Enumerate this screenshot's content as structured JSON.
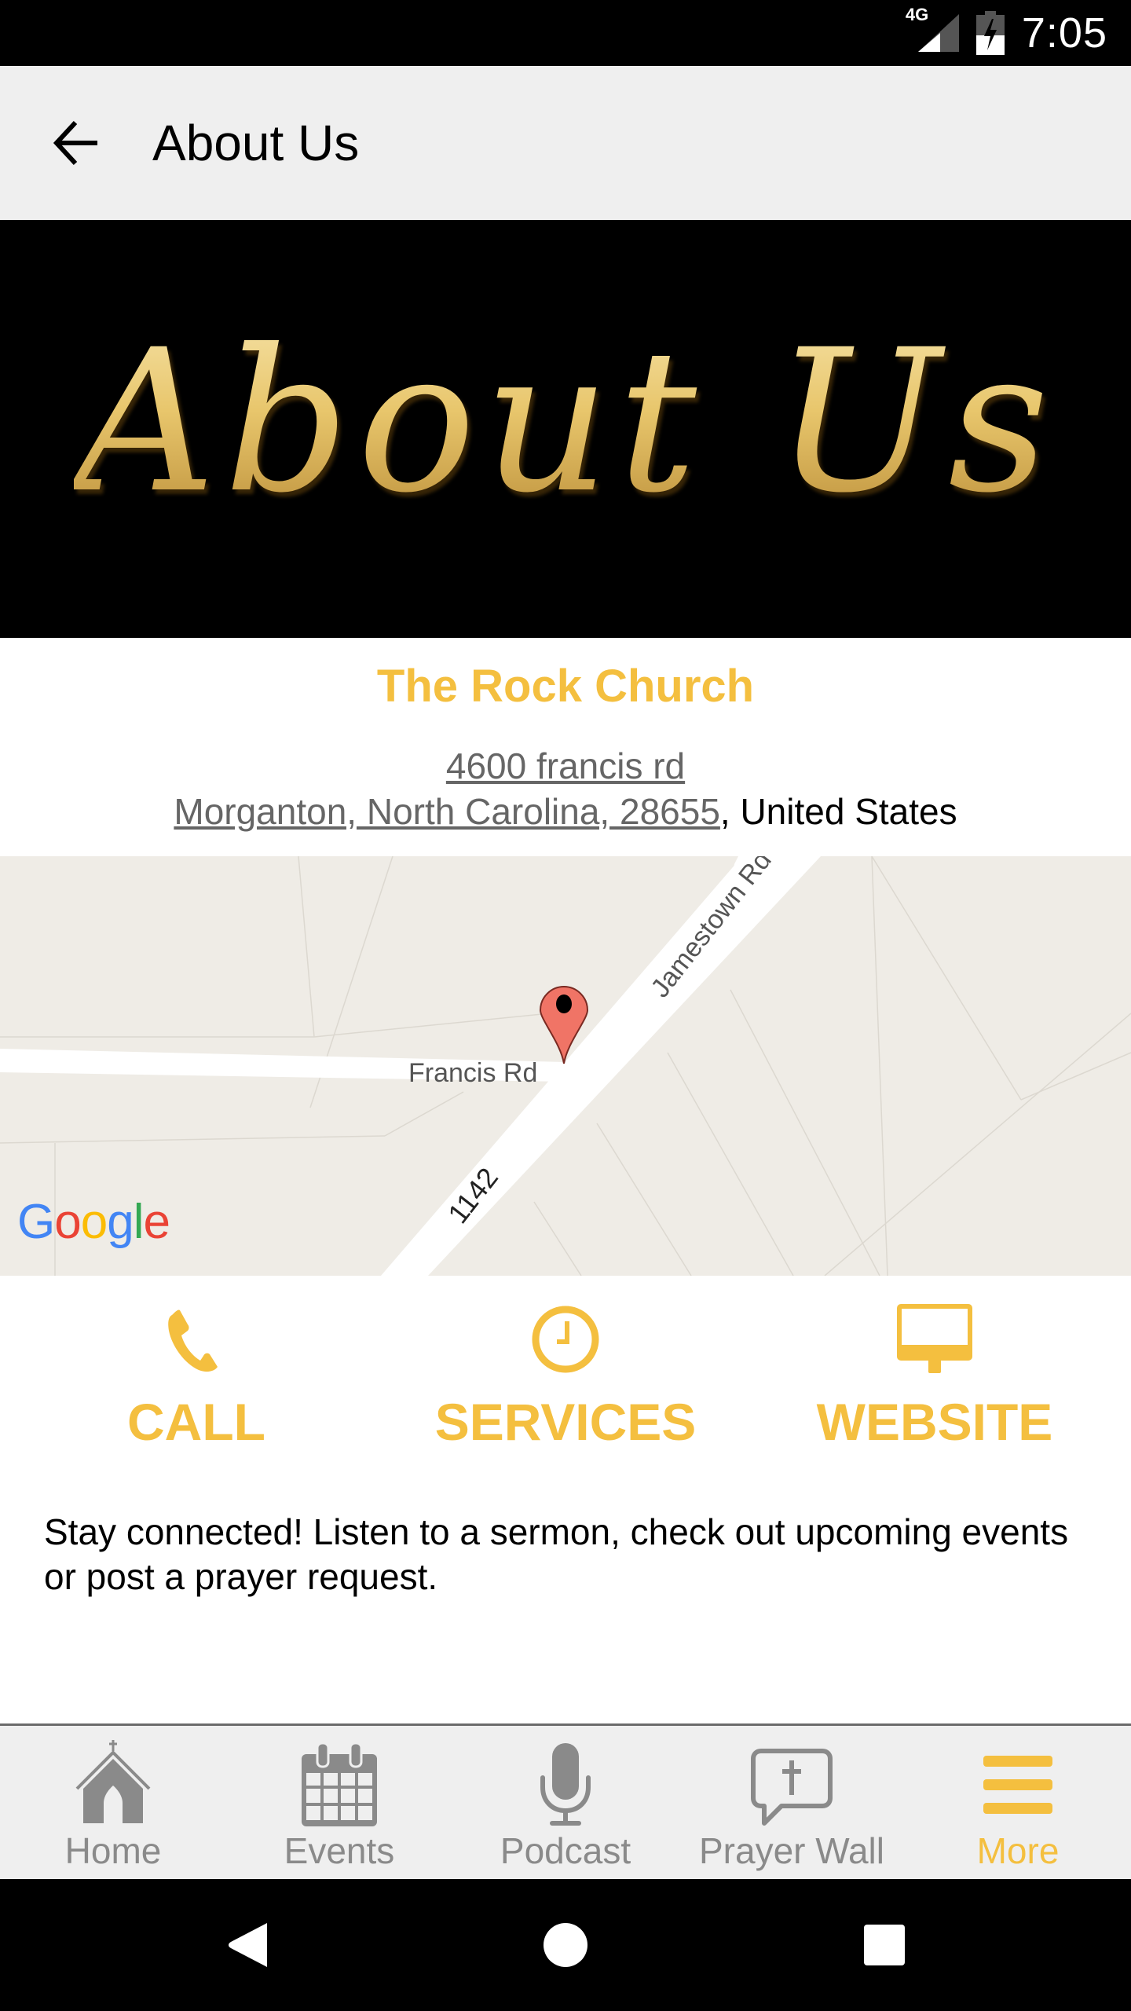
{
  "status_bar": {
    "network": "4G",
    "time": "7:05",
    "icons": [
      "signal-icon",
      "battery-charging-icon"
    ]
  },
  "app_bar": {
    "back_icon": "arrow-left-icon",
    "title": "About Us"
  },
  "banner": {
    "text": "About Us"
  },
  "church": {
    "name": "The Rock Church",
    "address_line1": "4600 francis rd",
    "address_line2": "Morganton, North Carolina, 28655",
    "country_suffix": ", United States"
  },
  "map": {
    "labels": {
      "road_1": "Jamestown Rd",
      "road_2": "Francis Rd",
      "road_3": "1142"
    },
    "logo": "Google",
    "logo_colors": [
      "#4285F4",
      "#EA4335",
      "#FBBC05",
      "#4285F4",
      "#34A853",
      "#EA4335"
    ],
    "marker_color": "#f07466"
  },
  "actions": [
    {
      "label": "CALL",
      "icon": "phone-icon"
    },
    {
      "label": "SERVICES",
      "icon": "clock-icon"
    },
    {
      "label": "WEBSITE",
      "icon": "monitor-icon"
    }
  ],
  "blurb": "Stay connected! Listen to a sermon, check out upcoming events  or post a prayer request.",
  "bottom_nav": {
    "items": [
      {
        "label": "Home",
        "icon": "church-icon",
        "active": false
      },
      {
        "label": "Events",
        "icon": "calendar-icon",
        "active": false
      },
      {
        "label": "Podcast",
        "icon": "microphone-icon",
        "active": false
      },
      {
        "label": "Prayer Wall",
        "icon": "prayer-bubble-icon",
        "active": false
      },
      {
        "label": "More",
        "icon": "menu-icon",
        "active": true
      }
    ]
  },
  "system_nav": {
    "buttons": [
      "back-icon",
      "home-icon",
      "recents-icon"
    ]
  },
  "colors": {
    "accent": "#f4bf3f",
    "inactive": "#8a8a8a",
    "app_bar_bg": "#efefef",
    "map_bg": "#efece6"
  }
}
